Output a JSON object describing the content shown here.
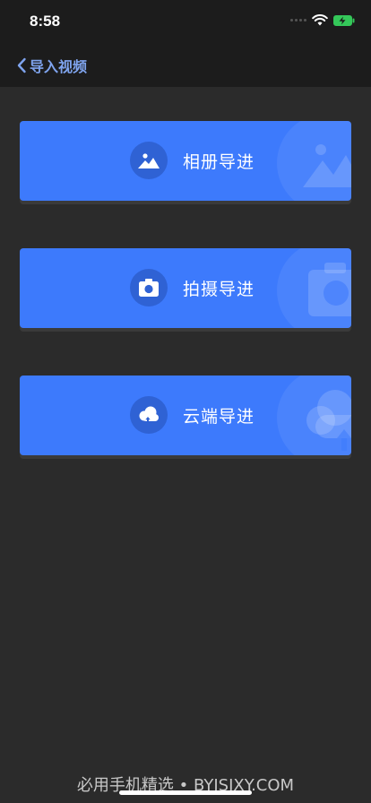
{
  "status_bar": {
    "time": "8:58"
  },
  "nav": {
    "back_label": "导入视频"
  },
  "cards": [
    {
      "label": "相册导进",
      "icon": "photo-landscape-icon"
    },
    {
      "label": "拍摄导进",
      "icon": "camera-icon"
    },
    {
      "label": "云端导进",
      "icon": "cloud-upload-icon"
    }
  ],
  "watermark": "必用手机精选 • BYJSJXY.COM",
  "colors": {
    "card": "#3d7afc",
    "background": "#2b2b2b",
    "nav": "#1c1c1c",
    "accent_text": "#7fa4ee"
  }
}
